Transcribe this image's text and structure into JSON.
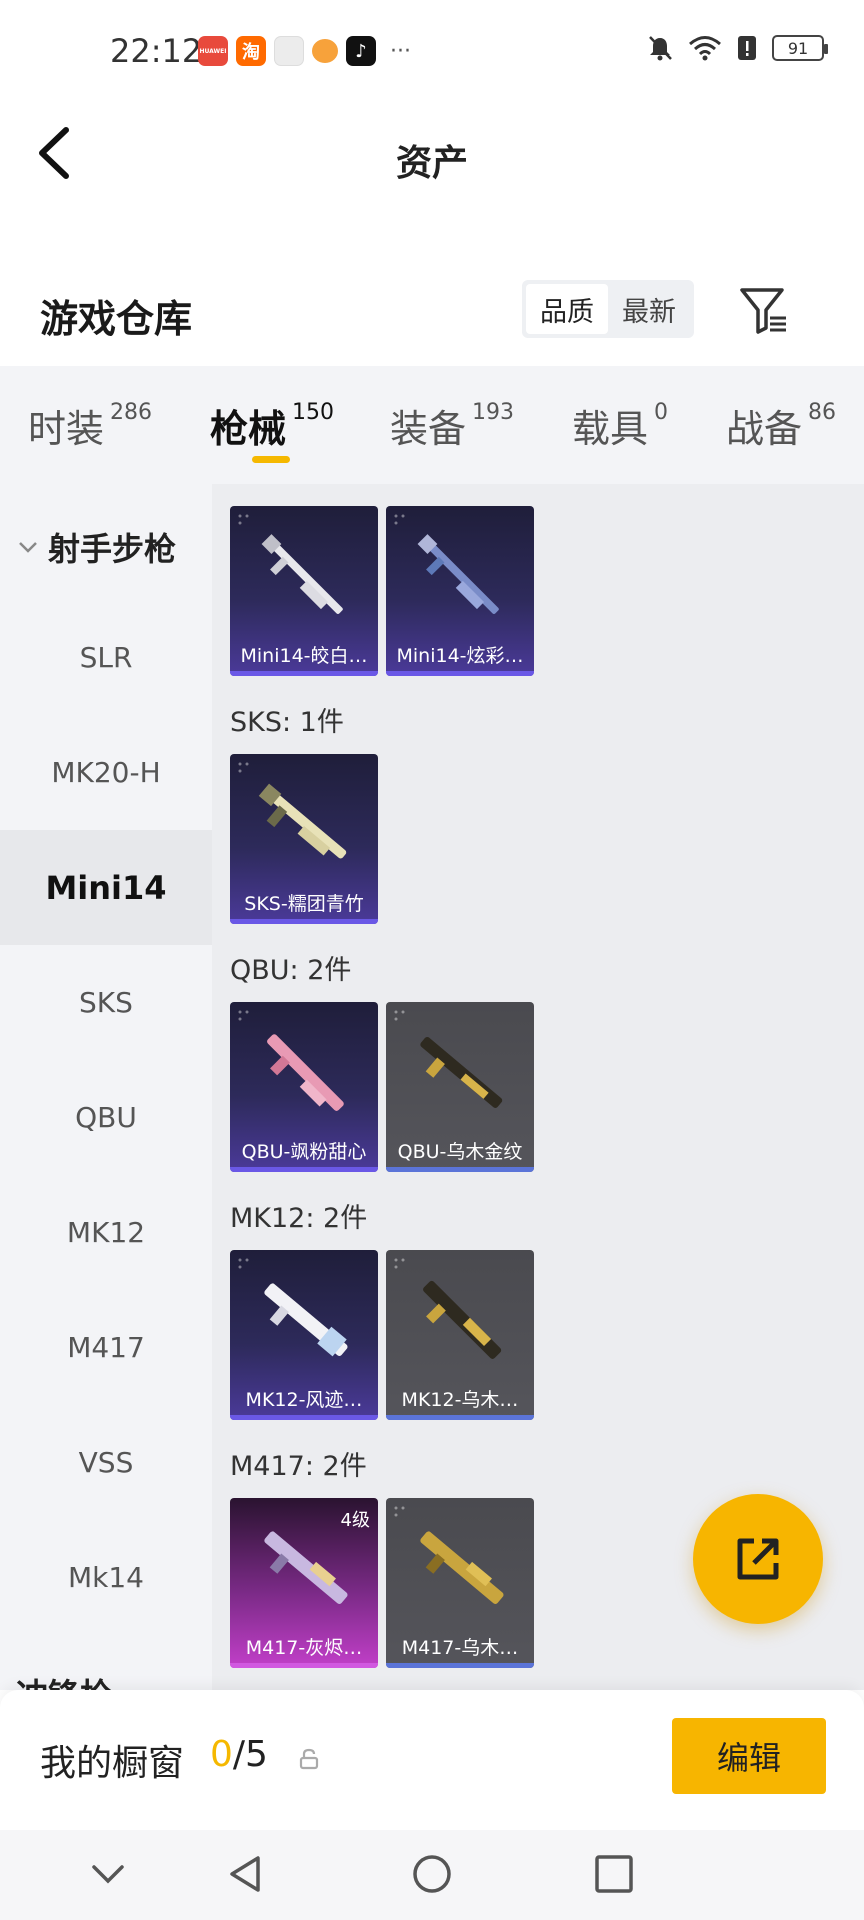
{
  "status_bar": {
    "time": "22:12",
    "more_indicator": "···",
    "battery": "91",
    "apps": [
      {
        "icon": "huawei-app-icon",
        "text": "HUAWEI",
        "color": "#e84a3c"
      },
      {
        "icon": "taobao-app-icon",
        "text": "淘",
        "color": "#ff6a00"
      },
      {
        "icon": "box-app-icon",
        "text": "",
        "color": "#ececec"
      },
      {
        "icon": "pumpkin-app-icon",
        "text": "",
        "color": "#f7a23b"
      },
      {
        "icon": "tiktok-app-icon",
        "text": "♪",
        "color": "#111111"
      }
    ]
  },
  "nav": {
    "title": "资产"
  },
  "warehouse": {
    "title": "游戏仓库",
    "sort_options": [
      {
        "label": "品质",
        "active": true
      },
      {
        "label": "最新",
        "active": false
      }
    ]
  },
  "tabs": [
    {
      "label": "时装",
      "count": "286",
      "active": false
    },
    {
      "label": "枪械",
      "count": "150",
      "active": true
    },
    {
      "label": "装备",
      "count": "193",
      "active": false
    },
    {
      "label": "载具",
      "count": "0",
      "active": false
    },
    {
      "label": "战备",
      "count": "86",
      "active": false
    }
  ],
  "sidebar": {
    "group": "射手步枪",
    "items": [
      "SLR",
      "MK20-H",
      "Mini14",
      "SKS",
      "QBU",
      "MK12",
      "M417",
      "VSS",
      "Mk14"
    ],
    "active_item": "Mini14",
    "next_group": "冲锋枪"
  },
  "content": {
    "top_cards": [
      {
        "label": "Mini14-皎白…",
        "style": "purple"
      },
      {
        "label": "Mini14-炫彩…",
        "style": "purple"
      }
    ],
    "sections": [
      {
        "title": "SKS: 1件",
        "cards": [
          {
            "label": "SKS-糯团青竹",
            "style": "purple"
          }
        ]
      },
      {
        "title": "QBU: 2件",
        "cards": [
          {
            "label": "QBU-飒粉甜心",
            "style": "purple"
          },
          {
            "label": "QBU-乌木金纹",
            "style": "gray"
          }
        ]
      },
      {
        "title": "MK12: 2件",
        "cards": [
          {
            "label": "MK12-风迹…",
            "style": "purple"
          },
          {
            "label": "MK12-乌木…",
            "style": "gray"
          }
        ]
      },
      {
        "title": "M417: 2件",
        "cards": [
          {
            "label": "M417-灰烬…",
            "style": "pink",
            "level": "4级"
          },
          {
            "label": "M417-乌木…",
            "style": "gray"
          }
        ]
      }
    ]
  },
  "showcase": {
    "label": "我的橱窗",
    "count_current": "0",
    "count_total": "/5",
    "edit_label": "编辑"
  },
  "colors": {
    "accent": "#f7b500",
    "purple_card": "#2d2a5a",
    "gray_card": "#55555b",
    "pink_card": "#c23fc9"
  }
}
